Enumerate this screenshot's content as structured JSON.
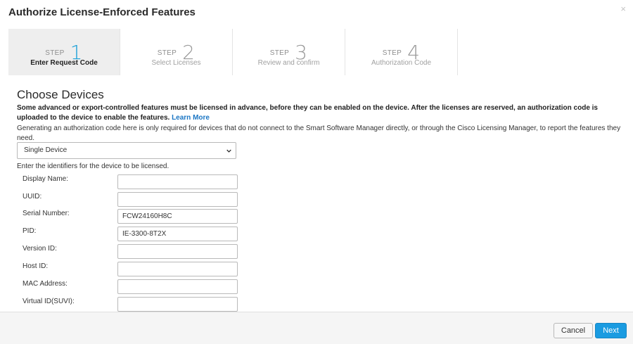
{
  "dialog": {
    "title": "Authorize License-Enforced Features",
    "close_glyph": "×"
  },
  "steps": [
    {
      "word": "STEP",
      "number": "1",
      "label": "Enter Request Code",
      "active": true
    },
    {
      "word": "STEP",
      "number": "2",
      "label": "Select Licenses",
      "active": false
    },
    {
      "word": "STEP",
      "number": "3",
      "label": "Review and confirm",
      "active": false
    },
    {
      "word": "STEP",
      "number": "4",
      "label": "Authorization Code",
      "active": false
    }
  ],
  "section": {
    "title": "Choose Devices",
    "intro_bold_line1": "Some advanced or export-controlled features must be licensed in advance, before they can be enabled on the device. After the licenses are reserved, an authorization code is uploaded to",
    "intro_bold_line2": "the device to enable the features.",
    "learn_more": "Learn More",
    "intro_normal": "Generating an authorization code here is only required for devices that do not connect to the Smart Software Manager directly, or through the Cisco Licensing Manager, to report the features they need."
  },
  "device_select": {
    "value": "Single Device"
  },
  "identifiers_note": "Enter the identifiers for the device to be licensed.",
  "fields": [
    {
      "label": "Display Name:",
      "value": ""
    },
    {
      "label": "UUID:",
      "value": ""
    },
    {
      "label": "Serial Number:",
      "value": "FCW24160H8C"
    },
    {
      "label": "PID:",
      "value": "IE-3300-8T2X"
    },
    {
      "label": "Version ID:",
      "value": ""
    },
    {
      "label": "Host ID:",
      "value": ""
    },
    {
      "label": "MAC Address:",
      "value": ""
    },
    {
      "label": "Virtual ID(SUVI):",
      "value": ""
    }
  ],
  "footer": {
    "cancel_label": "Cancel",
    "next_label": "Next"
  },
  "colors": {
    "accent": "#1ba0d8",
    "primary_button": "#1a9be1",
    "link": "#1b76c4"
  }
}
